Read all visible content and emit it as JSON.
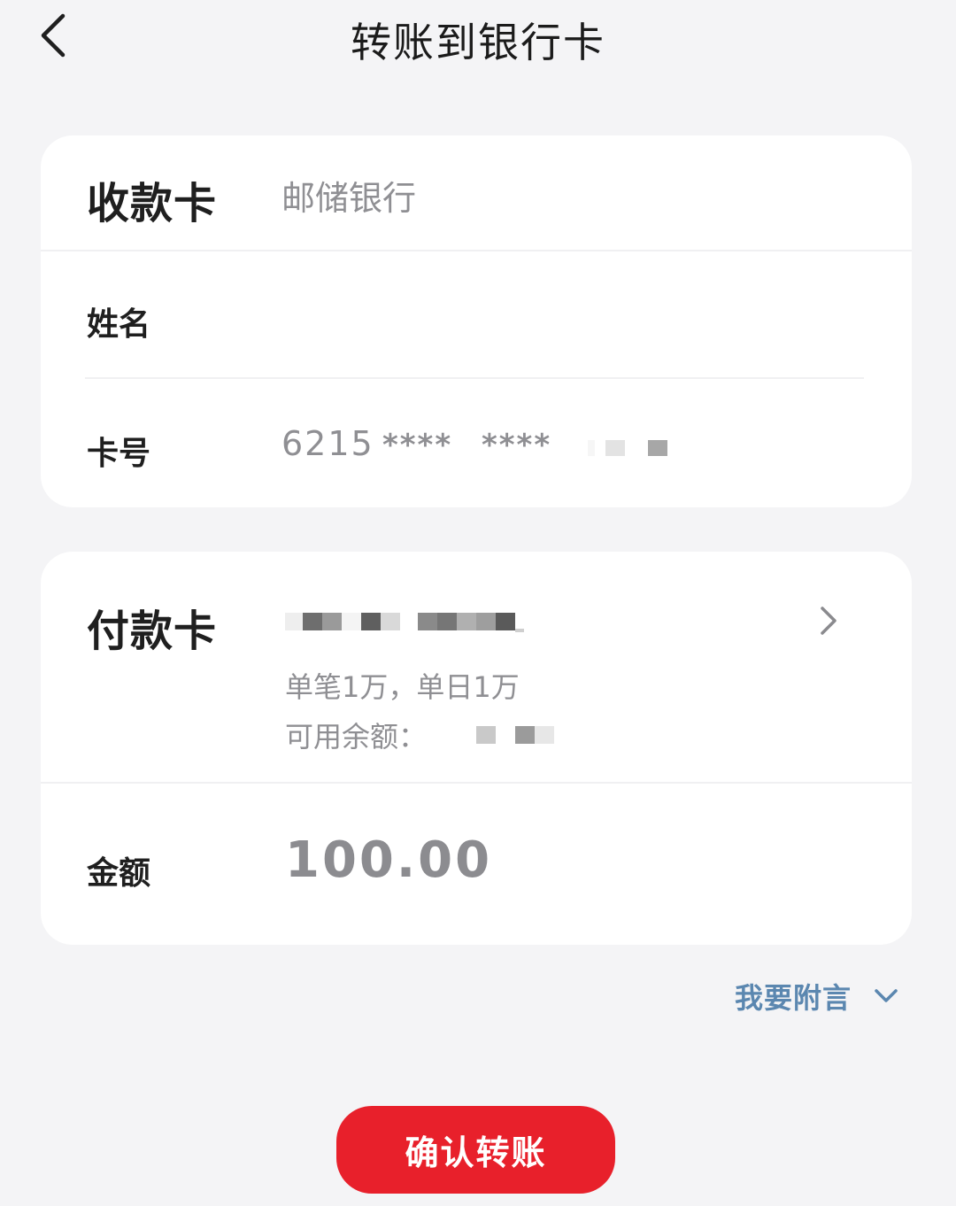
{
  "header": {
    "title": "转账到银行卡",
    "back_icon": "chevron-left-icon"
  },
  "payee_card": {
    "section_label": "收款卡",
    "bank_name": "邮储银行",
    "name_label": "姓名",
    "name_value": "",
    "card_no_label": "卡号",
    "card_no_prefix": "6215",
    "card_no_masked_1": "****",
    "card_no_masked_2": "****"
  },
  "payer_card": {
    "section_label": "付款卡",
    "limit_text": "单笔1万，单日1万",
    "balance_label": "可用余额：",
    "chevron_icon": "chevron-right-icon"
  },
  "amount": {
    "label": "金额",
    "value": "100.00"
  },
  "note": {
    "label": "我要附言",
    "icon": "chevron-down-icon",
    "color": "#5b87b0"
  },
  "confirm": {
    "label": "确认转账",
    "color": "#e8202b"
  }
}
